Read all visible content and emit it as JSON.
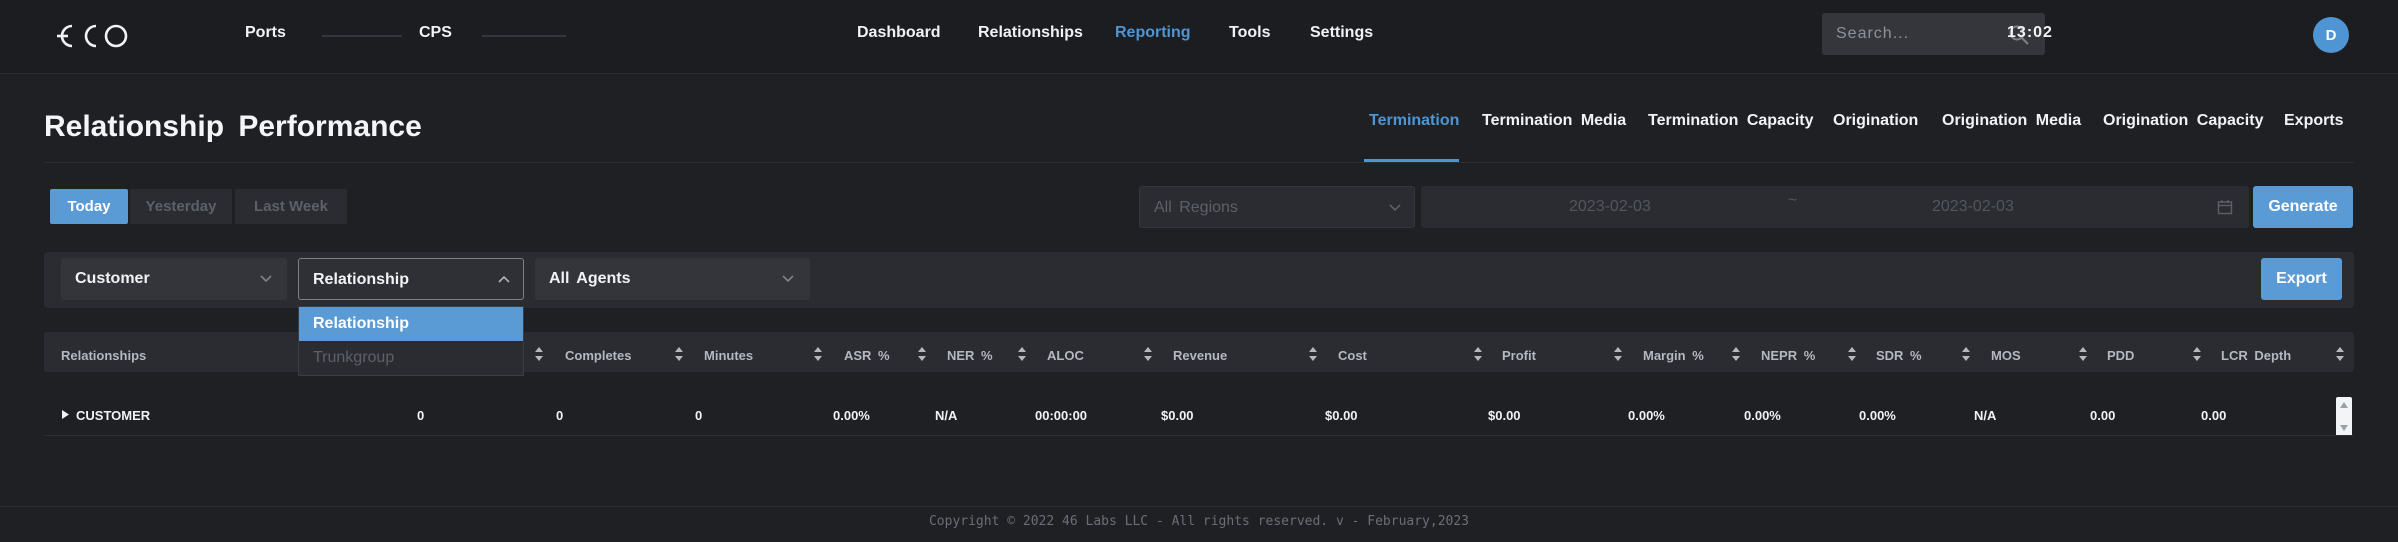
{
  "topbar": {
    "links": {
      "ports": "Ports",
      "cps": "CPS"
    },
    "nav": {
      "dashboard": "Dashboard",
      "relationships": "Relationships",
      "reporting": "Reporting",
      "tools": "Tools",
      "settings": "Settings"
    },
    "search_placeholder": "Search...",
    "clock": "13:02",
    "avatar_initial": "D"
  },
  "page": {
    "title": "Relationship Performance",
    "tabs": {
      "termination": "Termination",
      "termination_media": "Termination Media",
      "termination_capacity": "Termination Capacity",
      "origination": "Origination",
      "origination_media": "Origination Media",
      "origination_capacity": "Origination Capacity",
      "exports": "Exports"
    }
  },
  "date_controls": {
    "range_today": "Today",
    "range_yesterday": "Yesterday",
    "range_last_week": "Last Week",
    "region": "All Regions",
    "date_from": "2023-02-03",
    "date_separator": "~",
    "date_to": "2023-02-03",
    "generate_label": "Generate"
  },
  "filters": {
    "type": "Customer",
    "group_by": "Relationship",
    "agents": "All Agents",
    "export_label": "Export",
    "group_options": {
      "relationship": "Relationship",
      "trunkgroup": "Trunkgroup"
    }
  },
  "table": {
    "headers": {
      "relationships": "Relationships",
      "completes": "Completes",
      "minutes": "Minutes",
      "asr": "ASR %",
      "ner": "NER %",
      "aloc": "ALOC",
      "revenue": "Revenue",
      "cost": "Cost",
      "profit": "Profit",
      "margin": "Margin %",
      "nepr": "NEPR %",
      "sdr": "SDR %",
      "mos": "MOS",
      "pdd": "PDD",
      "lcr_depth": "LCR Depth"
    },
    "row": {
      "name": "CUSTOMER",
      "attempts": "0",
      "completes": "0",
      "minutes": "0",
      "asr": "0.00%",
      "ner": "N/A",
      "aloc": "00:00:00",
      "revenue": "$0.00",
      "cost": "$0.00",
      "profit": "$0.00",
      "margin": "0.00%",
      "nepr": "0.00%",
      "sdr": "0.00%",
      "mos": "N/A",
      "pdd": "0.00",
      "lcr_depth": "0.00"
    }
  },
  "footer": {
    "copyright": "Copyright © 2022 46 Labs LLC - All rights reserved. v - February,2023"
  },
  "colors": {
    "background": "#1f2024",
    "panel": "#2a2c31",
    "accent": "#5a9bd6",
    "active_link": "#4f95d3"
  }
}
